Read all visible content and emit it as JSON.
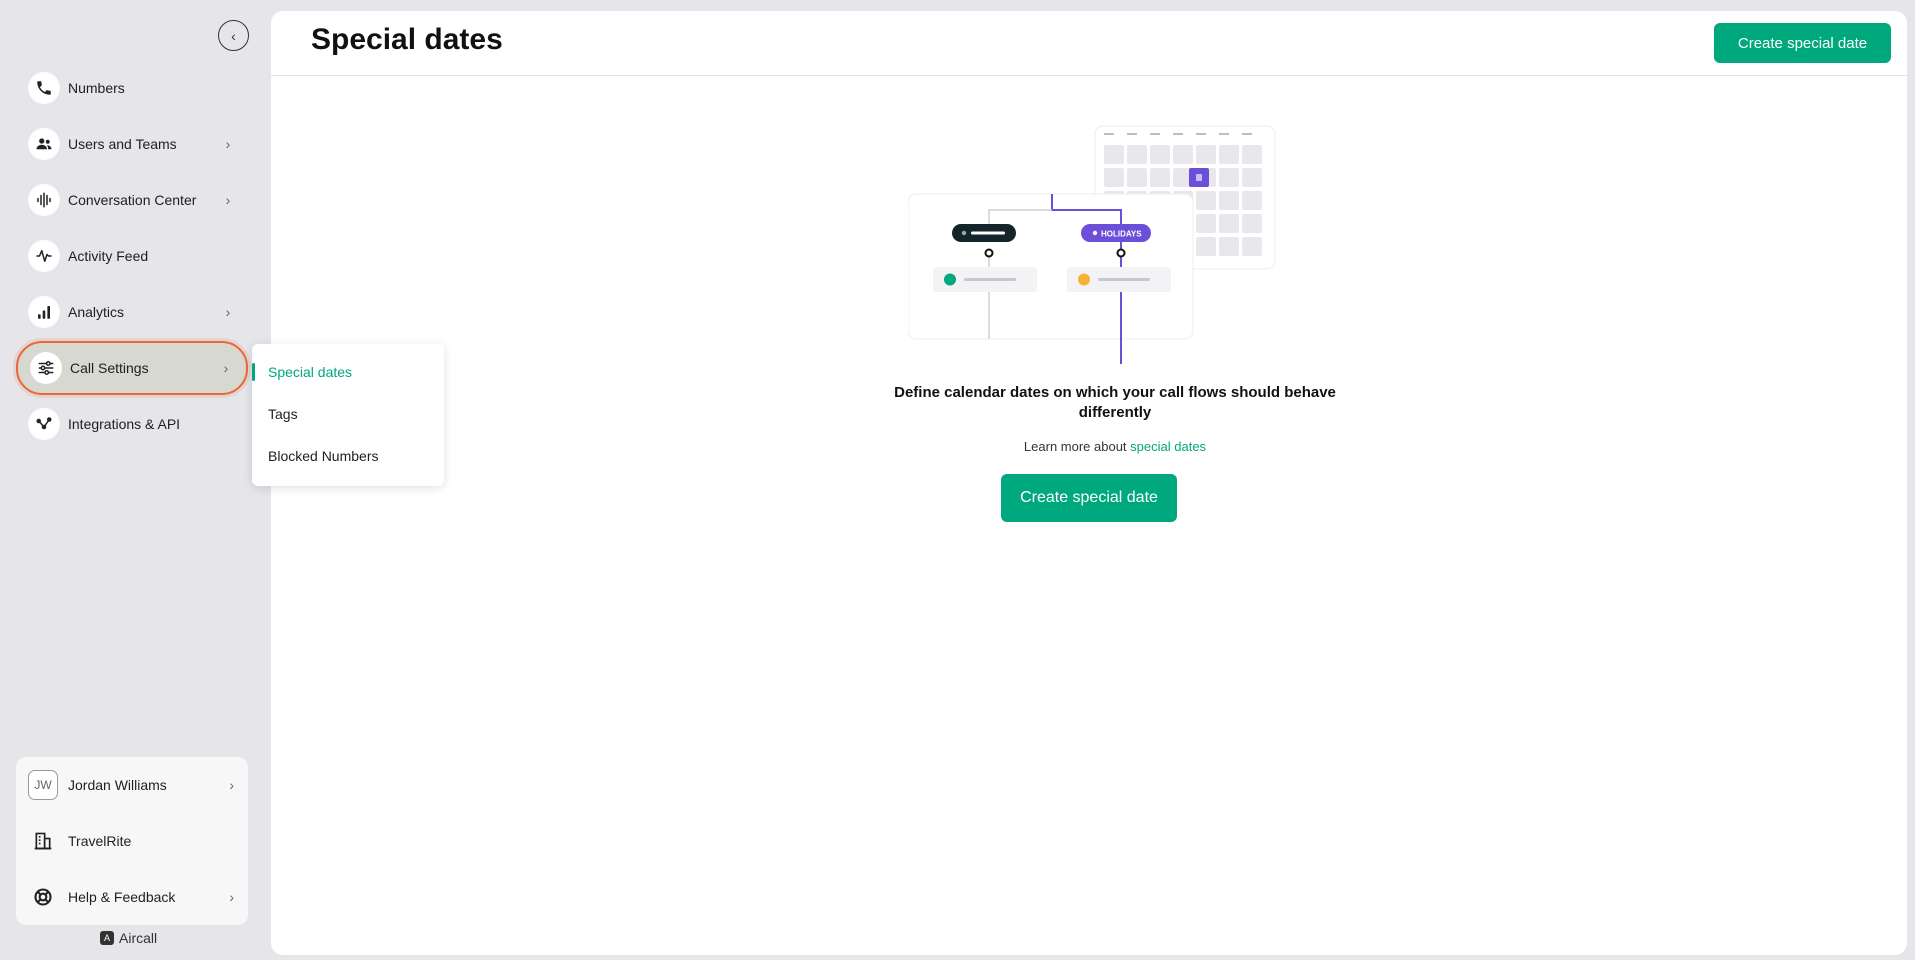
{
  "sidebar": {
    "items": [
      {
        "label": "Numbers",
        "icon": "phone-icon",
        "has_chevron": false
      },
      {
        "label": "Users and Teams",
        "icon": "users-icon",
        "has_chevron": true
      },
      {
        "label": "Conversation Center",
        "icon": "soundwave-icon",
        "has_chevron": true
      },
      {
        "label": "Activity Feed",
        "icon": "activity-pulse-icon",
        "has_chevron": false
      },
      {
        "label": "Analytics",
        "icon": "bar-chart-icon",
        "has_chevron": true
      },
      {
        "label": "Call Settings",
        "icon": "sliders-icon",
        "has_chevron": true,
        "active": true
      },
      {
        "label": "Integrations & API",
        "icon": "integrations-icon",
        "has_chevron": false
      }
    ],
    "bottom": {
      "user_initials": "JW",
      "user_name": "Jordan Williams",
      "company": "TravelRite",
      "help": "Help & Feedback"
    },
    "brand": "Aircall"
  },
  "submenu": {
    "items": [
      {
        "label": "Special dates",
        "active": true
      },
      {
        "label": "Tags"
      },
      {
        "label": "Blocked Numbers"
      }
    ]
  },
  "main": {
    "title": "Special dates",
    "header_button": "Create special date",
    "empty_state": {
      "title": "Define calendar dates on which your call flows should behave differently",
      "learn_prefix": "Learn more about",
      "learn_link": "special dates",
      "button": "Create special date"
    },
    "illustration": {
      "holidays_label": "HOLIDAYS"
    }
  },
  "colors": {
    "accent": "#00a87e",
    "active_border": "#e7693b",
    "purple": "#6b4fd8"
  }
}
